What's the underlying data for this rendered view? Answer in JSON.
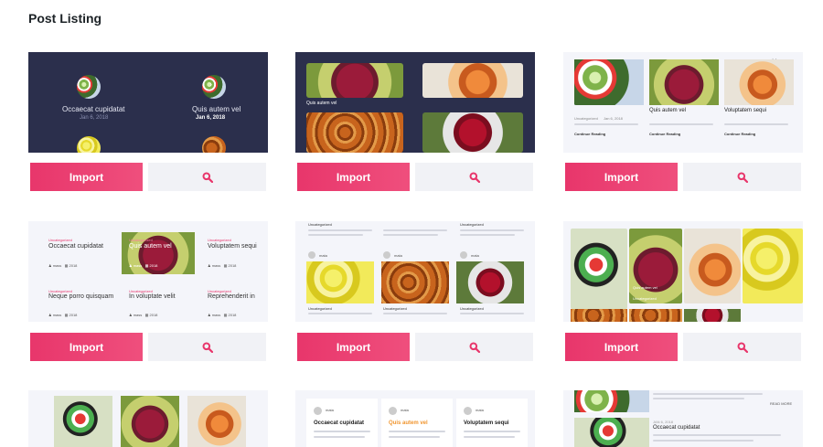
{
  "page": {
    "title": "Post Listing"
  },
  "buttons": {
    "import_label": "Import"
  },
  "templates": [
    {
      "titles": [
        "Occaecat cupidatat",
        "Quis autem vel"
      ],
      "dates": [
        "Jan 6, 2018",
        "Jan 6, 2018"
      ]
    },
    {
      "caption": "Quis autem vel"
    },
    {
      "titles": [
        "Quis autem vel",
        "Voluptatem sequi"
      ],
      "meta": "Uncategorized",
      "date": "Jan 6, 2018",
      "link": "Continue Reading"
    },
    {
      "category": "Uncategorized",
      "titles": [
        "Occaecat cupidatat",
        "Quis autem vel",
        "Voluptatem sequi",
        "Neque porro quisquam",
        "In voluptate velit",
        "Reprehenderit in"
      ],
      "meta": [
        "mass",
        "2018"
      ]
    },
    {
      "category": "Uncategorized",
      "author": "mata",
      "text": "Lorem ipsum dolor sit amet, consectetur adipiscing elit, do eiusmod tempor."
    },
    {
      "caption": "Quis autem vel",
      "category": "Uncategorized"
    },
    {},
    {
      "author": "mata",
      "titles": [
        "Occaecat cupidatat",
        "Quis autem vel",
        "Voluptatem sequi"
      ],
      "text": "Lorem ipsum dolor sit amet, consectetur adipiscing elit, do eiusmod tempor."
    },
    {
      "date": "JAN 6, 2018",
      "title": "Occaecat cupidatat",
      "more": "READ MORE"
    }
  ]
}
